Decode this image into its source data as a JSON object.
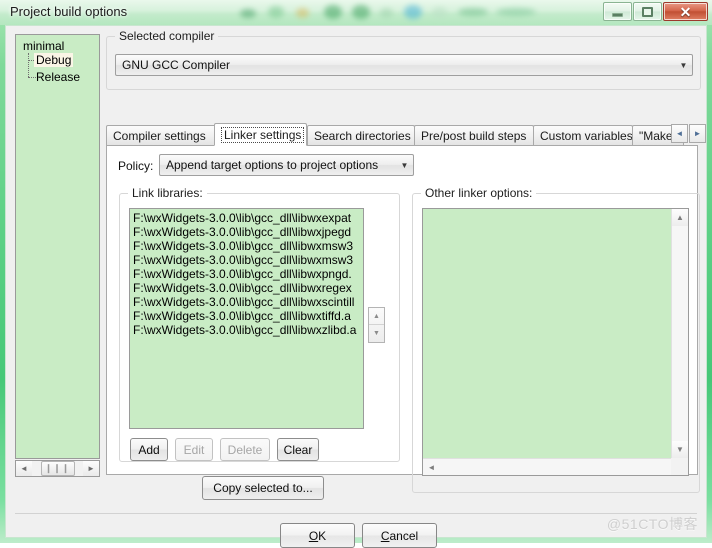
{
  "window": {
    "title": "Project build options",
    "controls": {
      "minimize": "minimize-button",
      "maximize": "maximize-button",
      "close": "✕"
    }
  },
  "tree": {
    "root": "minimal",
    "children": [
      {
        "label": "Debug",
        "selected": true
      },
      {
        "label": "Release",
        "selected": false
      }
    ],
    "hscroll": {
      "left_arrow": "◄",
      "right_arrow": "►",
      "thumb": "❙❙❙"
    }
  },
  "compiler_group": {
    "title": "Selected compiler",
    "selected": "GNU GCC Compiler",
    "arrow": "▼"
  },
  "tabs": [
    {
      "label": "Compiler settings",
      "active": false
    },
    {
      "label": "Linker settings",
      "active": true
    },
    {
      "label": "Search directories",
      "active": false
    },
    {
      "label": "Pre/post build steps",
      "active": false
    },
    {
      "label": "Custom variables",
      "active": false
    },
    {
      "label": "\"Make…",
      "active": false
    }
  ],
  "tab_spinner": {
    "left": "◄",
    "right": "►"
  },
  "policy": {
    "label": "Policy:",
    "value": "Append target options to project options",
    "arrow": "▼"
  },
  "link_libraries": {
    "title": "Link libraries:",
    "items": [
      "F:\\wxWidgets-3.0.0\\lib\\gcc_dll\\libwxexpat",
      "F:\\wxWidgets-3.0.0\\lib\\gcc_dll\\libwxjpegd",
      "F:\\wxWidgets-3.0.0\\lib\\gcc_dll\\libwxmsw3",
      "F:\\wxWidgets-3.0.0\\lib\\gcc_dll\\libwxmsw3",
      "F:\\wxWidgets-3.0.0\\lib\\gcc_dll\\libwxpngd.",
      "F:\\wxWidgets-3.0.0\\lib\\gcc_dll\\libwxregex",
      "F:\\wxWidgets-3.0.0\\lib\\gcc_dll\\libwxscintill",
      "F:\\wxWidgets-3.0.0\\lib\\gcc_dll\\libwxtiffd.a",
      "F:\\wxWidgets-3.0.0\\lib\\gcc_dll\\libwxzlibd.a"
    ],
    "reorder": {
      "up": "▲",
      "down": "▼"
    },
    "buttons": [
      {
        "label": "Add",
        "enabled": true
      },
      {
        "label": "Edit",
        "enabled": false
      },
      {
        "label": "Delete",
        "enabled": false
      },
      {
        "label": "Clear",
        "enabled": true
      }
    ],
    "copy_button": "Copy selected to..."
  },
  "other_linker_options": {
    "title": "Other linker options:",
    "value": "",
    "scroll": {
      "up": "▲",
      "down": "▼",
      "left": "◄",
      "right": "►"
    }
  },
  "dialog_buttons": {
    "ok": {
      "pre": "",
      "mnemonic": "O",
      "post": "K"
    },
    "cancel": {
      "pre": "",
      "mnemonic": "C",
      "post": "ancel"
    }
  },
  "watermark": "@51CTO博客",
  "colors": {
    "frame_green": "#5fd187",
    "field_green": "#c9ecc5",
    "dialog_bg": "#f0f0f0",
    "close_red": "#c14f33"
  }
}
